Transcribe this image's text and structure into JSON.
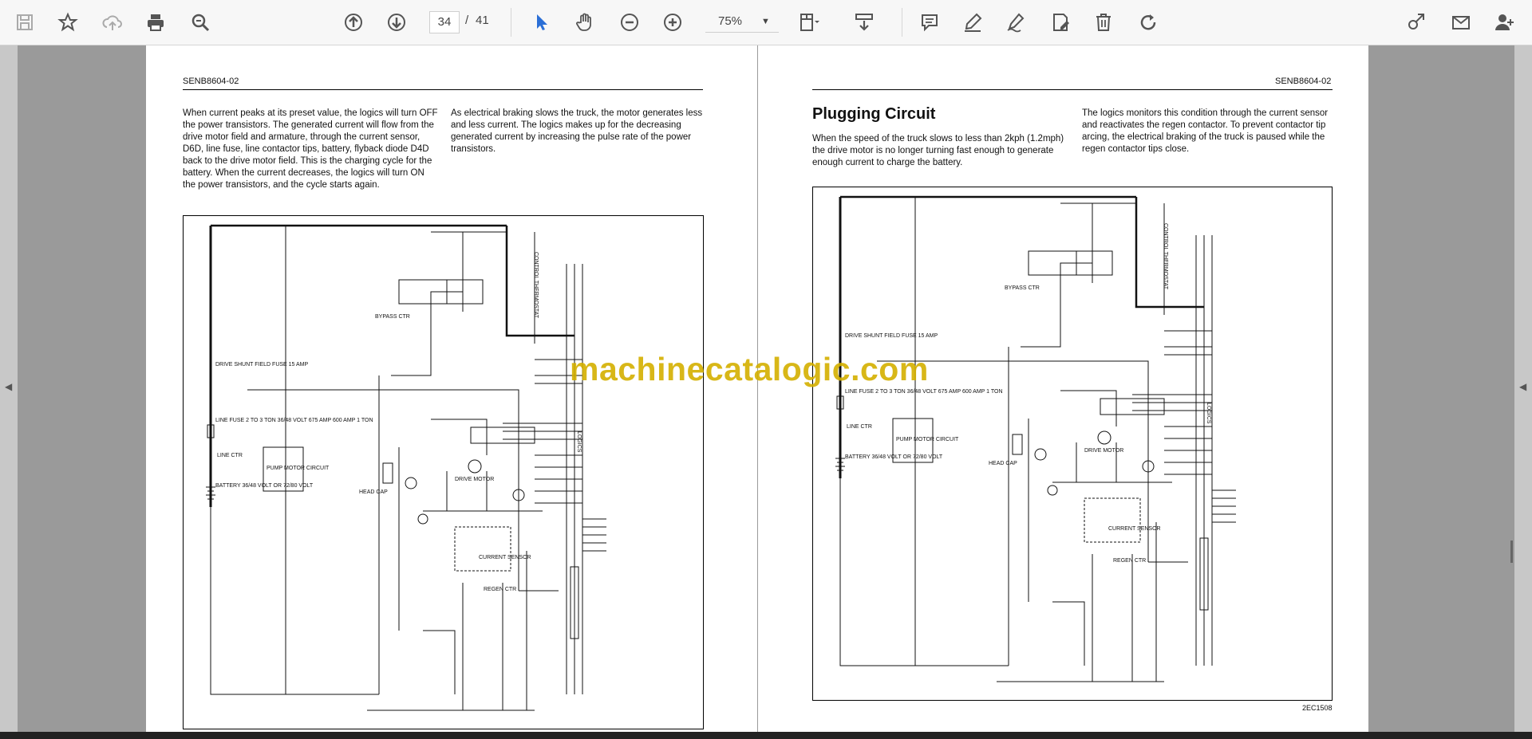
{
  "toolbar": {
    "current_page": "34",
    "separator": "/",
    "total_pages": "41",
    "zoom": "75%",
    "icons": [
      "save-icon",
      "bookmark-star-icon",
      "cloud-upload-icon",
      "print-icon",
      "zoom-search-icon",
      "page-up-icon",
      "page-down-icon",
      "select-cursor-icon",
      "hand-pan-icon",
      "zoom-out-icon",
      "zoom-in-icon",
      "fit-page-icon",
      "scroll-mode-icon",
      "comment-icon",
      "highlight-pen-icon",
      "draw-icon",
      "edit-text-icon",
      "delete-icon",
      "rotate-icon",
      "share-link-icon",
      "email-icon",
      "add-user-icon"
    ]
  },
  "left_page": {
    "header": "SENB8604-02",
    "col1": "When current peaks at its preset value, the logics will turn OFF the power transistors. The generated current will flow from the drive motor field and armature, through the current sensor, D6D, line fuse, line contactor tips, battery, flyback diode D4D back to the drive motor field. This is the charging cycle for the battery. When the current decreases, the logics will turn ON the power transistors, and the cycle starts again.",
    "col2": "As electrical braking slows the truck, the motor generates less and less current. The logics makes up for the decreasing generated current by increasing the pulse rate of the power transistors.",
    "labels": {
      "drive_fuse": "DRIVE SHUNT FIELD FUSE 15 AMP",
      "line_fuse": "LINE FUSE 2 TO 3 TON 36/48 VOLT 675 AMP 600 AMP 1 TON",
      "line_ctr": "LINE CTR",
      "battery": "BATTERY 36/48 VOLT OR 72/80 VOLT",
      "pump": "PUMP MOTOR CIRCUIT",
      "head_cap": "HEAD CAP",
      "bypass": "BYPASS CTR",
      "drive_motor": "DRIVE MOTOR",
      "current_sensor": "CURRENT SENSOR",
      "regen": "REGEN CTR",
      "logics": "LOGICS",
      "thermostat": "CONTROL THERMOSTAT"
    }
  },
  "right_page": {
    "header": "SENB8604-02",
    "heading": "Plugging Circuit",
    "col1": "When the speed of the truck slows to less than 2kph (1.2mph) the drive motor is no longer turning fast enough to generate enough current to charge the battery.",
    "col2": "The logics monitors this condition through the current sensor and reactivates the regen contactor. To prevent contactor tip arcing, the electrical braking of the truck is paused while the regen contactor tips close.",
    "figure_id": "2EC1508",
    "labels": {
      "drive_fuse": "DRIVE SHUNT FIELD FUSE 15 AMP",
      "line_fuse": "LINE FUSE 2 TO 3 TON 36/48 VOLT 675 AMP 600 AMP 1 TON",
      "line_ctr": "LINE CTR",
      "battery": "BATTERY 36/48 VOLT OR 72/80 VOLT",
      "pump": "PUMP MOTOR CIRCUIT",
      "head_cap": "HEAD CAP",
      "bypass": "BYPASS CTR",
      "drive_motor": "DRIVE MOTOR",
      "current_sensor": "CURRENT SENSOR",
      "regen": "REGEN CTR",
      "logics": "LOGICS",
      "thermostat": "CONTROL THERMOSTAT"
    }
  },
  "watermark": "machinecatalogic.com"
}
